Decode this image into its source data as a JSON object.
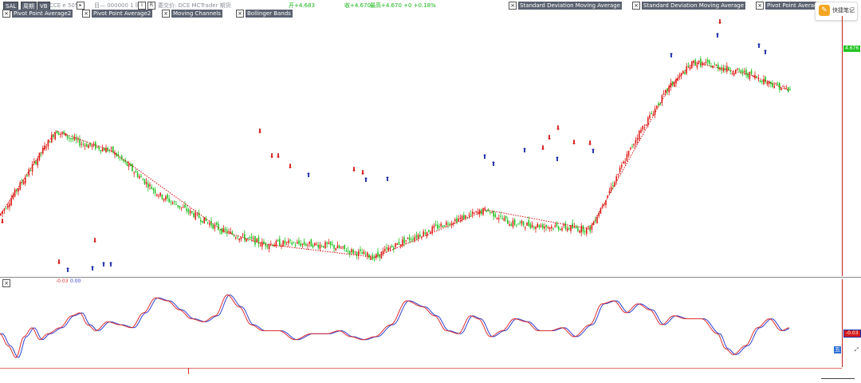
{
  "toolbar": {
    "btn1": "SAL",
    "btn2": "周期",
    "btn3": "VB",
    "code": "CCE e 5050",
    "period": "目— 000000  1 时",
    "exchange": "委交价: DCE  MCTrader  期货",
    "price1": "开+4.683",
    "price2": "收+4.670",
    "price3": "最高+4.670  +0 +0.18%"
  },
  "indicators_row1": [
    "Pivot Point Average2",
    "Standard Deviation Moving Average",
    "Standard Deviation Moving Average",
    "Pivot Point Average"
  ],
  "indicators_row2": [
    "Pivot Point Average2",
    "Pivot Point Average2",
    "Moving Channels",
    "Bollinger Bands"
  ],
  "note_app": {
    "label": "快捷笔记"
  },
  "osc_values": {
    "v1": "-0.03",
    "v2": "0.00"
  },
  "price_tag": "4.676",
  "osc_tag": "-0.03",
  "colors": {
    "up": "#e0201a",
    "down": "#22c422",
    "osc1": "#e03030",
    "osc2": "#3040d0",
    "buy": "#1a2aa8",
    "sell": "#d41a1a"
  },
  "chart_data": {
    "type": "candlestick",
    "title": "",
    "xlabel": "",
    "ylabel": "",
    "price_line": [
      [
        0,
        8
      ],
      [
        70,
        29
      ],
      [
        100,
        26
      ],
      [
        140,
        24
      ],
      [
        200,
        13
      ],
      [
        280,
        4
      ],
      [
        330,
        0.8
      ],
      [
        360,
        1
      ],
      [
        410,
        0.5
      ],
      [
        470,
        -2.5
      ],
      [
        500,
        1
      ],
      [
        560,
        6
      ],
      [
        610,
        9.3
      ],
      [
        640,
        6
      ],
      [
        700,
        5
      ],
      [
        740,
        4.5
      ],
      [
        800,
        28
      ],
      [
        840,
        40
      ],
      [
        870,
        46
      ],
      [
        900,
        45
      ],
      [
        940,
        43
      ],
      [
        990,
        39
      ]
    ],
    "oscillator": {
      "name": "",
      "points": [
        [
          0,
          0.3
        ],
        [
          10,
          -0.1
        ],
        [
          20,
          -0.5
        ],
        [
          30,
          0.2
        ],
        [
          40,
          0.5
        ],
        [
          50,
          0.1
        ],
        [
          60,
          0.3
        ],
        [
          75,
          0.5
        ],
        [
          90,
          0.9
        ],
        [
          100,
          1.0
        ],
        [
          110,
          0.6
        ],
        [
          120,
          0.4
        ],
        [
          135,
          0.7
        ],
        [
          150,
          0.6
        ],
        [
          165,
          0.5
        ],
        [
          180,
          1.0
        ],
        [
          195,
          1.5
        ],
        [
          210,
          1.4
        ],
        [
          225,
          1.1
        ],
        [
          240,
          0.8
        ],
        [
          255,
          0.7
        ],
        [
          270,
          0.9
        ],
        [
          285,
          1.6
        ],
        [
          300,
          1.2
        ],
        [
          315,
          0.6
        ],
        [
          330,
          0.4
        ],
        [
          350,
          0.4
        ],
        [
          370,
          0.1
        ],
        [
          390,
          0.3
        ],
        [
          410,
          0.3
        ],
        [
          425,
          0.4
        ],
        [
          440,
          0.2
        ],
        [
          455,
          0.1
        ],
        [
          470,
          0.2
        ],
        [
          490,
          0.6
        ],
        [
          510,
          1.4
        ],
        [
          530,
          1.2
        ],
        [
          545,
          0.9
        ],
        [
          560,
          0.4
        ],
        [
          575,
          0.3
        ],
        [
          590,
          0.9
        ],
        [
          600,
          0.8
        ],
        [
          615,
          0.2
        ],
        [
          630,
          0.4
        ],
        [
          645,
          0.8
        ],
        [
          660,
          0.7
        ],
        [
          675,
          0.4
        ],
        [
          690,
          0.4
        ],
        [
          705,
          0.5
        ],
        [
          720,
          0.2
        ],
        [
          740,
          0.6
        ],
        [
          755,
          1.3
        ],
        [
          770,
          1.4
        ],
        [
          785,
          1.0
        ],
        [
          800,
          1.3
        ],
        [
          815,
          1.1
        ],
        [
          830,
          0.6
        ],
        [
          845,
          0.9
        ],
        [
          860,
          0.8
        ],
        [
          880,
          0.8
        ],
        [
          900,
          0.3
        ],
        [
          910,
          -0.2
        ],
        [
          920,
          -0.4
        ],
        [
          935,
          -0.1
        ],
        [
          950,
          0.5
        ],
        [
          965,
          0.8
        ],
        [
          980,
          0.4
        ],
        [
          990,
          0.5
        ]
      ]
    },
    "signals": {
      "sell": [
        [
          3,
          280
        ],
        [
          74,
          331
        ],
        [
          119,
          304
        ],
        [
          326,
          167
        ],
        [
          341,
          198
        ],
        [
          349,
          198
        ],
        [
          364,
          211
        ],
        [
          444,
          215
        ],
        [
          455,
          219
        ],
        [
          681,
          188
        ],
        [
          689,
          175
        ],
        [
          700,
          163
        ],
        [
          720,
          181
        ],
        [
          740,
          182
        ],
        [
          903,
          30
        ]
      ],
      "buy": [
        [
          85,
          341
        ],
        [
          116,
          339
        ],
        [
          130,
          334
        ],
        [
          139,
          334
        ],
        [
          387,
          222
        ],
        [
          459,
          228
        ],
        [
          486,
          227
        ],
        [
          608,
          199
        ],
        [
          619,
          208
        ],
        [
          658,
          191
        ],
        [
          699,
          202
        ],
        [
          744,
          192
        ],
        [
          842,
          72
        ],
        [
          900,
          47
        ],
        [
          952,
          60
        ],
        [
          960,
          68
        ]
      ]
    }
  }
}
